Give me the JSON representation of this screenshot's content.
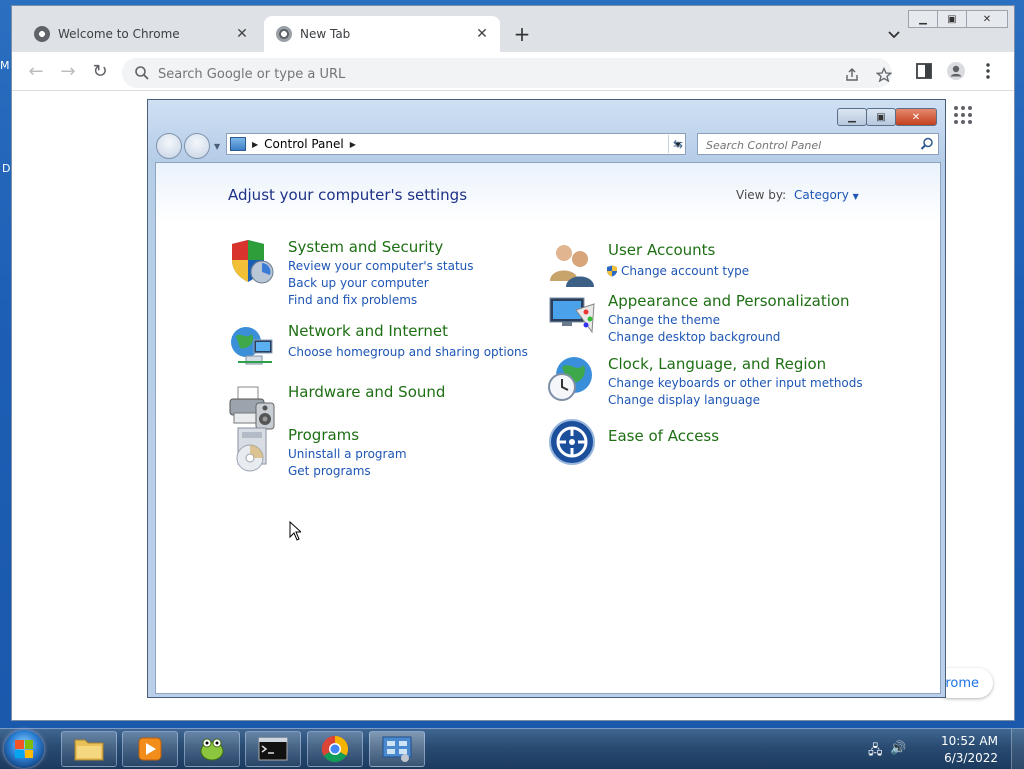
{
  "desktop": {
    "fragment_left_1": "M",
    "fragment_left_2": "D"
  },
  "chrome": {
    "tabs": [
      {
        "title": "Welcome to Chrome",
        "icon": "chrome-globe-icon"
      },
      {
        "title": "New Tab",
        "icon": "chrome-logo-icon"
      }
    ],
    "omnibox_placeholder": "Search Google or type a URL",
    "customize_label": "rome"
  },
  "control_panel": {
    "breadcrumb": "Control Panel",
    "search_placeholder": "Search Control Panel",
    "heading": "Adjust your computer's settings",
    "view_by_label": "View by:",
    "view_by_value": "Category",
    "categories_left": [
      {
        "title": "System and Security",
        "icon": "shield-security-icon",
        "links": [
          "Review your computer's status",
          "Back up your computer",
          "Find and fix problems"
        ]
      },
      {
        "title": "Network and Internet",
        "icon": "globe-network-icon",
        "links": [
          "Choose homegroup and sharing options"
        ]
      },
      {
        "title": "Hardware and Sound",
        "icon": "printer-speaker-icon",
        "links": []
      },
      {
        "title": "Programs",
        "icon": "programs-disc-icon",
        "links": [
          "Uninstall a program",
          "Get programs"
        ]
      }
    ],
    "categories_right": [
      {
        "title": "User Accounts",
        "icon": "users-icon",
        "links": [
          "Change account type"
        ]
      },
      {
        "title": "Appearance and Personalization",
        "icon": "monitor-palette-icon",
        "links": [
          "Change the theme",
          "Change desktop background"
        ]
      },
      {
        "title": "Clock, Language, and Region",
        "icon": "clock-globe-icon",
        "links": [
          "Change keyboards or other input methods",
          "Change display language"
        ]
      },
      {
        "title": "Ease of Access",
        "icon": "ease-of-access-icon",
        "links": []
      }
    ]
  },
  "taskbar": {
    "apps": [
      "file-explorer-icon",
      "media-player-icon",
      "notepad-plus-icon",
      "command-prompt-icon",
      "chrome-icon",
      "control-panel-icon"
    ],
    "time": "10:52 AM",
    "date": "6/3/2022"
  },
  "colors": {
    "link": "#1e56b5",
    "category_title": "#1e6f14",
    "heading": "#1e3287"
  }
}
